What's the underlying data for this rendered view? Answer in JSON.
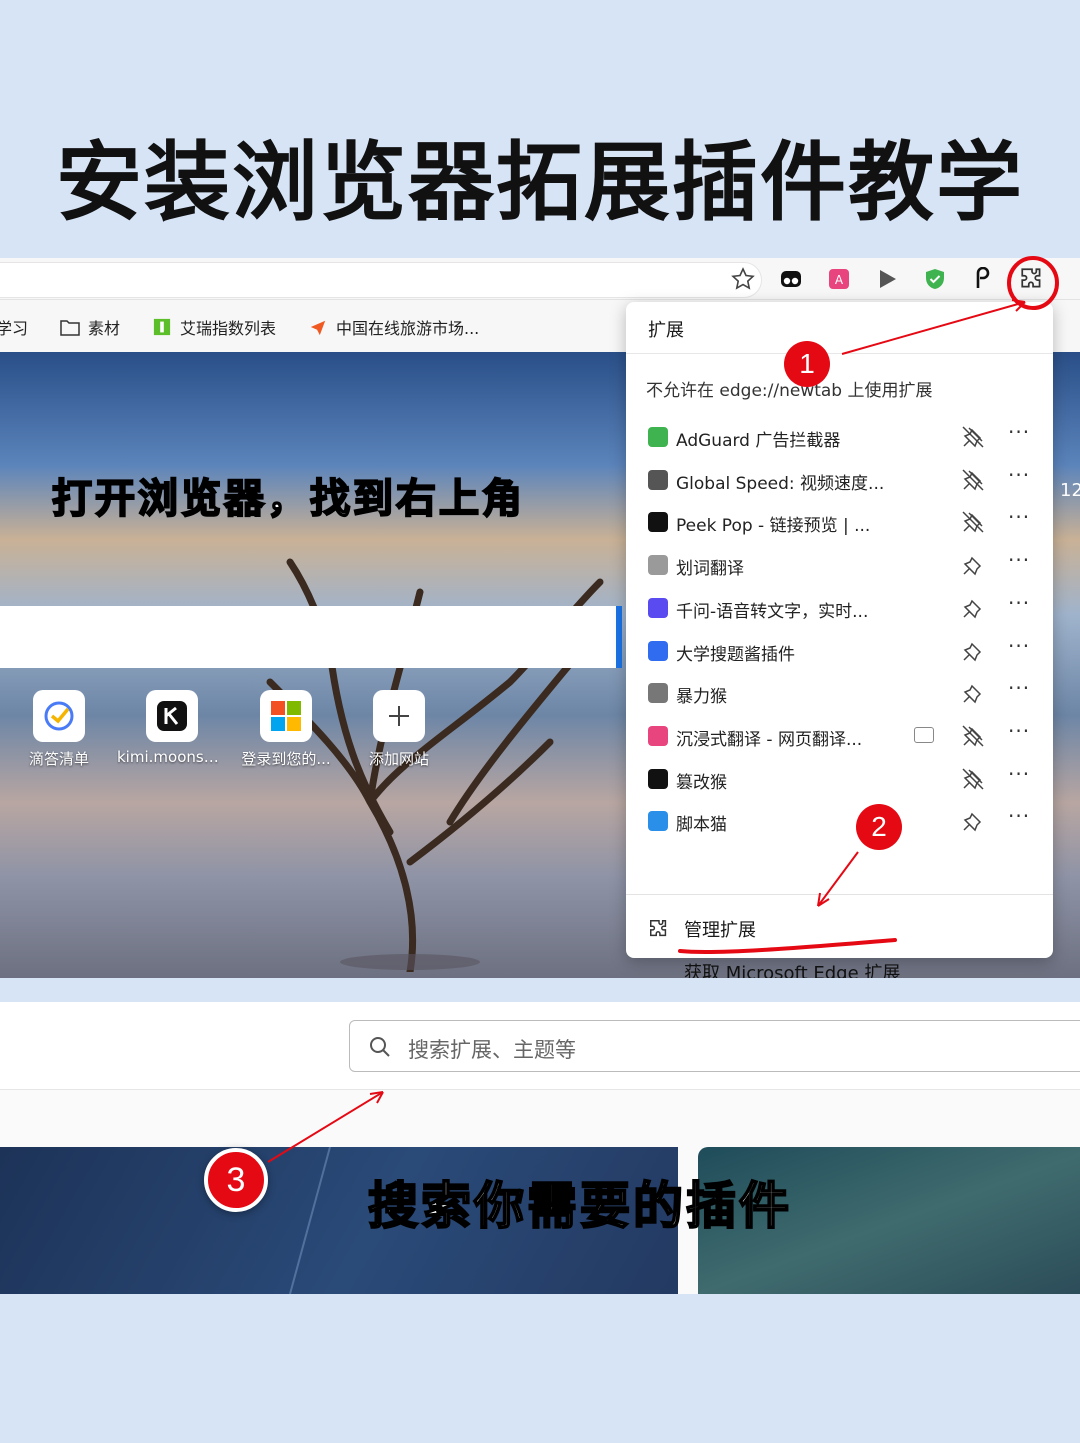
{
  "page_title": "安装浏览器拓展插件教学",
  "bookmarks": [
    {
      "label": "学习",
      "icon": "folder-icon"
    },
    {
      "label": "素材",
      "icon": "folder-icon"
    },
    {
      "label": "艾瑞指数列表",
      "icon": "iresearch-icon"
    },
    {
      "label": "中国在线旅游市场...",
      "icon": "bird-logo-icon"
    }
  ],
  "hero": {
    "caption": "打开浏览器，找到右上角",
    "clock": "12"
  },
  "quick_links": [
    {
      "label": "滴答清单",
      "icon": "ticktick-icon"
    },
    {
      "label": "kimi.moonsh...",
      "icon": "kimi-icon"
    },
    {
      "label": "登录到您的...",
      "icon": "microsoft-icon"
    },
    {
      "label": "添加网站",
      "icon": "plus-icon"
    }
  ],
  "extensions_panel": {
    "title": "扩展",
    "notice": "不允许在 edge://newtab 上使用扩展",
    "items": [
      {
        "name": "AdGuard 广告拦截器",
        "icon": "adguard-shield-icon",
        "color": "#3fb34f",
        "pinned": true
      },
      {
        "name": "Global Speed: 视频速度...",
        "icon": "play-triangle-icon",
        "color": "#555555",
        "pinned": true
      },
      {
        "name": "Peek Pop - 链接预览 | ...",
        "icon": "peek-pop-icon",
        "color": "#111111",
        "pinned": true
      },
      {
        "name": "划词翻译",
        "icon": "translate-icon",
        "color": "#9a9a9a",
        "pinned": false
      },
      {
        "name": "千问-语音转文字，实时...",
        "icon": "qianwen-icon",
        "color": "#5a4bf0",
        "pinned": false
      },
      {
        "name": "大学搜题酱插件",
        "icon": "search-question-icon",
        "color": "#2f6cf0",
        "pinned": false
      },
      {
        "name": "暴力猴",
        "icon": "violentmonkey-icon",
        "color": "#777777",
        "pinned": false
      },
      {
        "name": "沉浸式翻译 - 网页翻译...",
        "icon": "immersive-translate-icon",
        "color": "#e8447e",
        "pinned": true,
        "sidebar": true
      },
      {
        "name": "篡改猴",
        "icon": "tampermonkey-icon",
        "color": "#111111",
        "pinned": true
      },
      {
        "name": "脚本猫",
        "icon": "scriptcat-icon",
        "color": "#2a8fe8",
        "pinned": false
      }
    ],
    "more_label": "···",
    "manage_label": "管理扩展",
    "get_extensions_label": "获取 Microsoft Edge 扩展"
  },
  "store": {
    "search_placeholder": "搜索扩展、主题等",
    "caption": "搜索你需要的插件"
  },
  "steps": [
    "1",
    "2",
    "3"
  ],
  "colors": {
    "annotation_red": "#e50914",
    "background": "#d6e4f6",
    "accent_blue": "#1a73e8"
  }
}
